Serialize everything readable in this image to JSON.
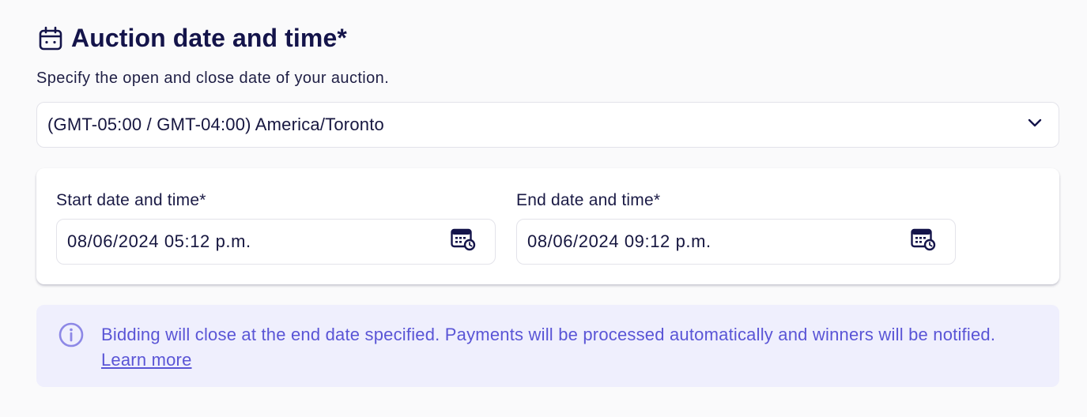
{
  "section": {
    "title": "Auction date and time*",
    "description": "Specify the open and close date of your auction."
  },
  "timezone": {
    "selected": "(GMT-05:00 / GMT-04:00) America/Toronto"
  },
  "start": {
    "label": "Start date and time*",
    "value": "08/06/2024 05:12 p.m."
  },
  "end": {
    "label": "End date and time*",
    "value": "08/06/2024 09:12 p.m."
  },
  "info": {
    "message": "Bidding will close at the end date specified. Payments will be processed automatically and winners will be notified.",
    "link_label": "Learn more"
  },
  "icons": {
    "header": "calendar-icon",
    "dropdown": "chevron-down-icon",
    "picker": "calendar-clock-icon",
    "info": "info-icon"
  },
  "colors": {
    "title": "#14144a",
    "info_background": "#efeffd",
    "info_text": "#5a55d6",
    "info_icon": "#8d88e6"
  }
}
